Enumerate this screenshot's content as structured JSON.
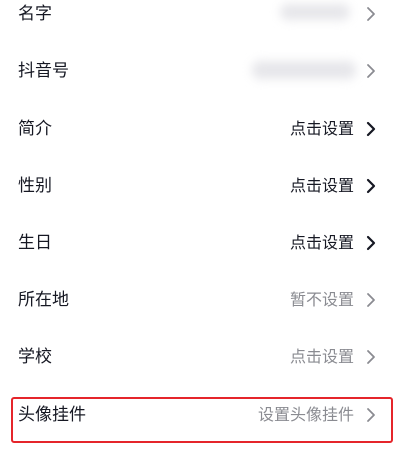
{
  "rows": [
    {
      "label": "名字",
      "value": "",
      "style": "blurred"
    },
    {
      "label": "抖音号",
      "value": "",
      "style": "blurred"
    },
    {
      "label": "简介",
      "value": "点击设置",
      "style": "dark"
    },
    {
      "label": "性别",
      "value": "点击设置",
      "style": "dark"
    },
    {
      "label": "生日",
      "value": "点击设置",
      "style": "dark"
    },
    {
      "label": "所在地",
      "value": "暂不设置",
      "style": "gray"
    },
    {
      "label": "学校",
      "value": "点击设置",
      "style": "gray"
    },
    {
      "label": "头像挂件",
      "value": "设置头像挂件",
      "style": "gray"
    }
  ],
  "icons": {
    "chevron": "chevron-right-icon"
  },
  "colors": {
    "highlight": "#e5252b",
    "text_primary": "#161823",
    "text_secondary": "#8a8b91"
  }
}
